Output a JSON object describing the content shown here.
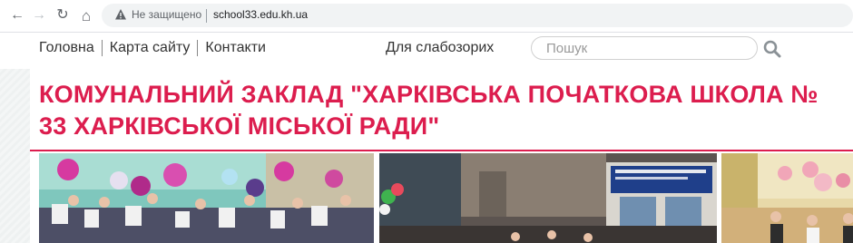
{
  "browser": {
    "security_label": "Не защищено",
    "url": "school33.edu.kh.ua",
    "back_icon": "←",
    "forward_icon": "→",
    "reload_icon": "↻",
    "home_icon": "⌂"
  },
  "header": {
    "nav": [
      "Головна",
      "Карта сайту",
      "Контакти"
    ],
    "low_vision": "Для слабозорих",
    "search_placeholder": "Пошук"
  },
  "site": {
    "title": "КОМУНАЛЬНИЙ ЗАКЛАД \"ХАРКІВСЬКА ПОЧАТКОВА ШКОЛА № 33 ХАРКІВСЬКОЇ МІСЬКОЇ РАДИ\"",
    "accent_color": "#dc1d4e"
  },
  "photos": [
    "classroom-celebration-photo",
    "school-entrance-photo",
    "balloon-hall-photo"
  ]
}
